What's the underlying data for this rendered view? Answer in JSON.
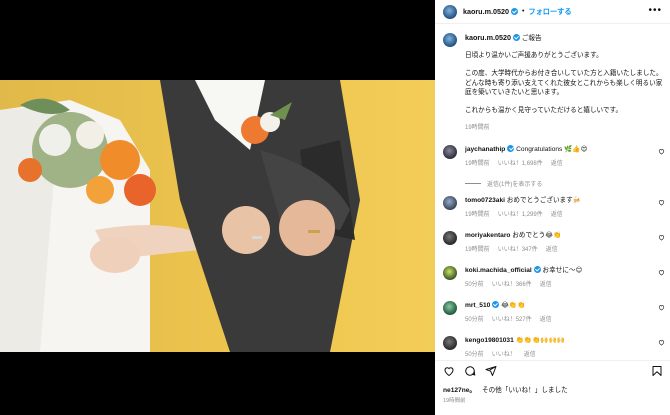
{
  "post": {
    "username": "kaoru.m.0520",
    "follow_label": "フォローする",
    "more_label": "•••"
  },
  "caption": {
    "username": "kaoru.m.0520",
    "title": "ご報告",
    "lines": [
      "日頃より温かいご声援ありがとうございます。",
      "",
      "この度、大学時代からお付き合いしていた方と入籍いたしました。",
      "どんな時も寄り添い支えてくれた彼女とこれからも楽しく明るい家庭を築いていきたいと思います。",
      "",
      "これからも温かく見守っていただけると嬉しいです。"
    ],
    "time": "19時間前"
  },
  "comments": [
    {
      "username": "jaychanathip",
      "text": "Congratulations 🌿👍😍",
      "time": "19時間前",
      "likes": "いいね！1,698件",
      "reply": "返信",
      "view_replies": "返信(1件)を表示する"
    },
    {
      "username": "tomo0723aki",
      "text": "おめでとうございます🍻",
      "time": "19時間前",
      "likes": "いいね！1,299件",
      "reply": "返信"
    },
    {
      "username": "moriyakentaro",
      "text": "おめでとう😂👏",
      "time": "19時間前",
      "likes": "いいね！347件",
      "reply": "返信"
    },
    {
      "username": "koki.machida_official",
      "text": "お幸せに〜😊",
      "time": "50分前",
      "likes": "いいね！366件",
      "reply": "返信"
    },
    {
      "username": "mrt_510",
      "text": "😂👏👏",
      "time": "50分前",
      "likes": "いいね！527件",
      "reply": "返信"
    },
    {
      "username": "kengo19801031",
      "text": "👏👏👏🙌🙌🙌",
      "time": "50分前",
      "likes": "いいね！",
      "reply": "返信"
    }
  ],
  "actions": {
    "liked_by_user": "ne127ne。",
    "liked_by_text": "その他「いいね！」しました",
    "time": "19時間前"
  },
  "colors": {
    "accent": "#0095f6",
    "verified": "#1c96e8",
    "muted": "#8e8e8e",
    "photo_background": "#e8c04c"
  }
}
